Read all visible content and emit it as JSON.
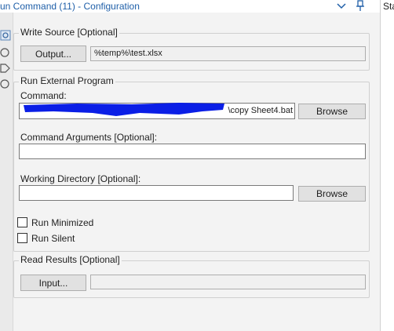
{
  "window": {
    "title": "un Command (11) - Configuration",
    "right_panel_text": "Sta"
  },
  "write_source": {
    "legend": "Write Source [Optional]",
    "output_button": "Output...",
    "path_value": "%temp%\\test.xlsx"
  },
  "run_external": {
    "legend": "Run External Program",
    "command_label": "Command:",
    "command_value": "\\copy Sheet4.bat",
    "command_browse": "Browse",
    "args_label": "Command Arguments [Optional]:",
    "args_value": "",
    "workdir_label": "Working Directory [Optional]:",
    "workdir_value": "",
    "workdir_browse": "Browse"
  },
  "options": {
    "run_minimized": {
      "label": "Run Minimized",
      "checked": false
    },
    "run_silent": {
      "label": "Run Silent",
      "checked": false
    }
  },
  "read_results": {
    "legend": "Read Results [Optional]",
    "input_button": "Input...",
    "path_value": ""
  },
  "colors": {
    "title_text": "#1f5fa8",
    "redaction": "#0a1ee6"
  },
  "icons": [
    "chevron-down-icon",
    "pin-icon",
    "gear-icon",
    "circle-icon",
    "tag-icon",
    "note-icon"
  ]
}
